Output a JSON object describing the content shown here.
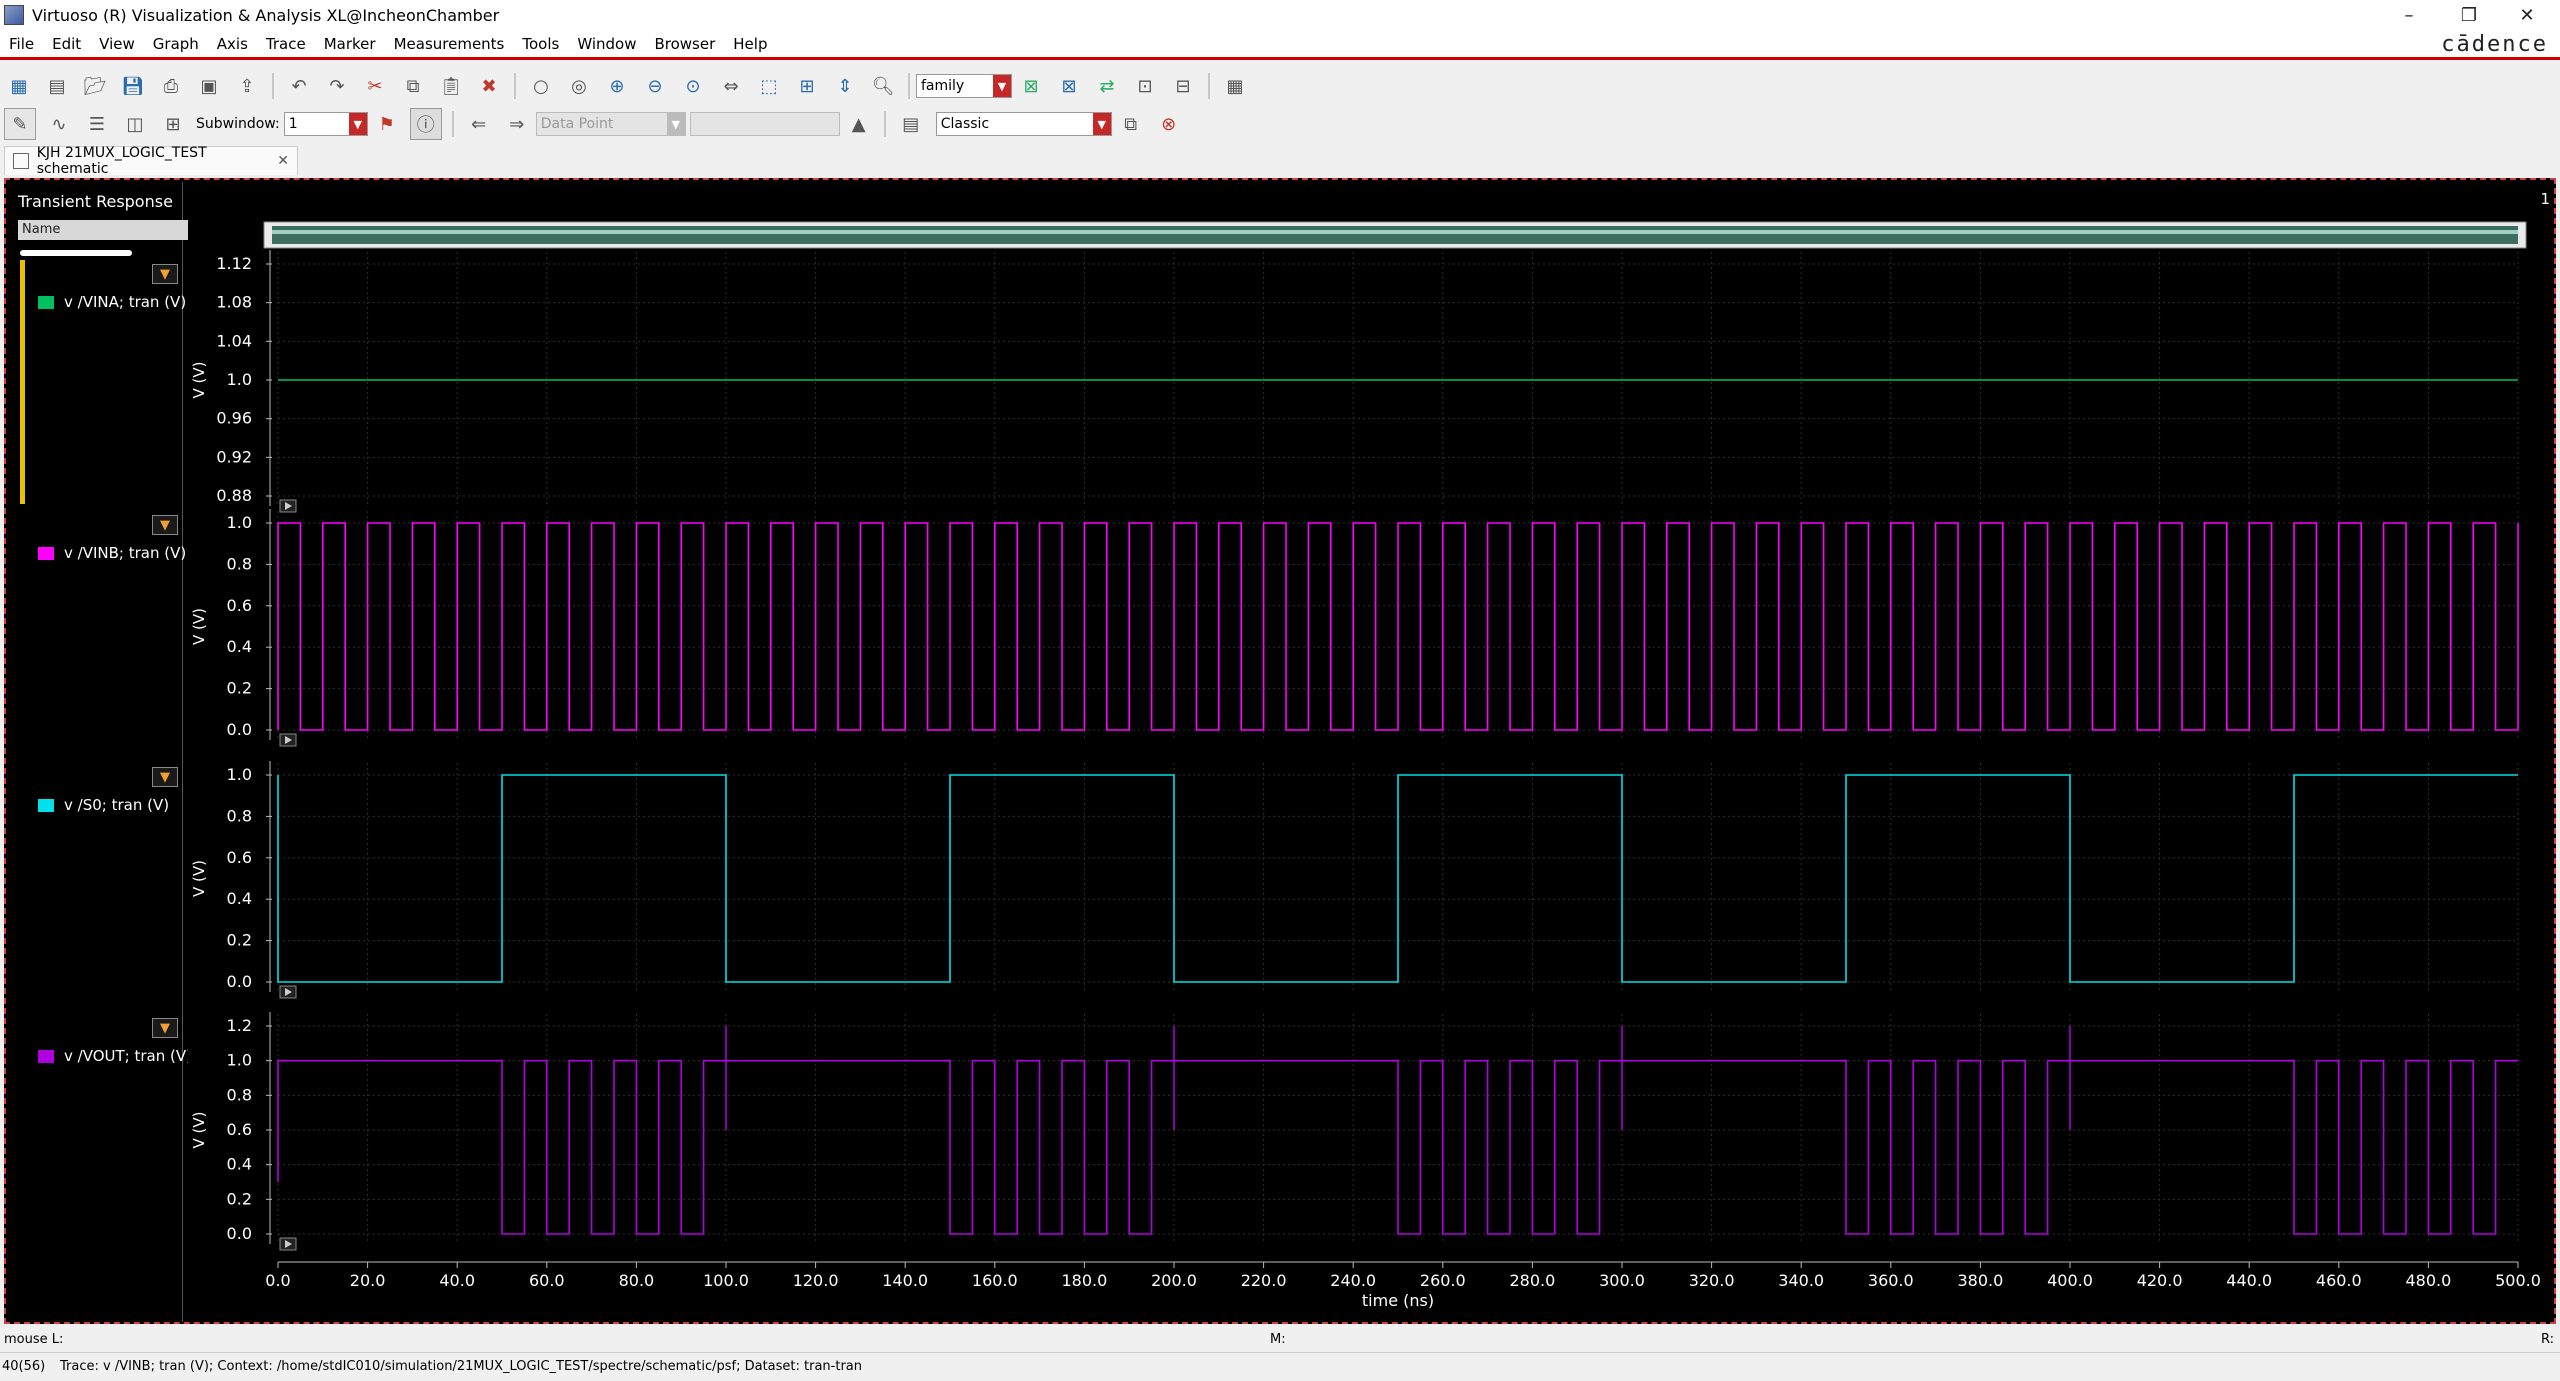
{
  "window": {
    "title": "Virtuoso (R) Visualization & Analysis XL@IncheonChamber",
    "brand": "cādence"
  },
  "menu": [
    "File",
    "Edit",
    "View",
    "Graph",
    "Axis",
    "Trace",
    "Marker",
    "Measurements",
    "Tools",
    "Window",
    "Browser",
    "Help"
  ],
  "toolbar": {
    "family_combo": "family",
    "subwindow_label": "Subwindow:",
    "subwindow_value": "1",
    "datapoint_combo": "Data Point",
    "style_combo": "Classic"
  },
  "tab": {
    "label": "KJH 21MUX_LOGIC_TEST schematic"
  },
  "plot": {
    "title": "Transient Response",
    "name_header": "Name",
    "panel_number": "1",
    "xlabel": "time (ns)"
  },
  "colors": {
    "vina": "#00c060",
    "vinb": "#ff00ff",
    "s0": "#00e0e8",
    "vout": "#b000e0",
    "grid": "#2e2e2e",
    "axis": "#bbbbbb"
  },
  "chart_data": [
    {
      "type": "line",
      "series": [
        {
          "name": "v /VINA; tran (V)",
          "x": [
            0,
            500
          ],
          "y": [
            1.0,
            1.0
          ]
        }
      ],
      "ylabel": "V (V)",
      "ylim": [
        0.88,
        1.12
      ],
      "yticks": [
        "1.12",
        "1.08",
        "1.04",
        "1.0",
        "0.96",
        "0.92",
        "0.88"
      ],
      "xlim": [
        0,
        500
      ]
    },
    {
      "type": "line",
      "series": [
        {
          "name": "v /VINB; tran (V)",
          "waveform": "square",
          "period_ns": 10,
          "high_first_ns": 0,
          "low": 0.0,
          "high": 1.0,
          "duty": 0.5
        }
      ],
      "ylabel": "V (V)",
      "ylim": [
        0.0,
        1.0
      ],
      "yticks": [
        "1.0",
        "0.8",
        "0.6",
        "0.4",
        "0.2",
        "0.0"
      ],
      "xlim": [
        0,
        500
      ]
    },
    {
      "type": "line",
      "series": [
        {
          "name": "v /S0; tran (V)",
          "waveform": "square",
          "period_ns": 100,
          "low": 0.0,
          "high": 1.0,
          "first_rise_ns": 50
        }
      ],
      "ylabel": "V (V)",
      "ylim": [
        0.0,
        1.0
      ],
      "yticks": [
        "1.0",
        "0.8",
        "0.6",
        "0.4",
        "0.2",
        "0.0"
      ],
      "xlim": [
        0,
        500
      ]
    },
    {
      "type": "line",
      "series": [
        {
          "name": "v /VOUT; tran (V)",
          "description_values": {
            "low": 0.0,
            "high": 1.0,
            "spike_high": 1.2
          }
        }
      ],
      "ylabel": "V (V)",
      "ylim": [
        0.0,
        1.2
      ],
      "yticks": [
        "1.2",
        "1.0",
        "0.8",
        "0.6",
        "0.4",
        "0.2",
        "0.0"
      ],
      "xlim": [
        0,
        500
      ]
    }
  ],
  "xticks": [
    "0.0",
    "20.0",
    "40.0",
    "60.0",
    "80.0",
    "100.0",
    "120.0",
    "140.0",
    "160.0",
    "180.0",
    "200.0",
    "220.0",
    "240.0",
    "260.0",
    "280.0",
    "300.0",
    "320.0",
    "340.0",
    "360.0",
    "380.0",
    "400.0",
    "420.0",
    "440.0",
    "460.0",
    "480.0",
    "500.0"
  ],
  "legend_items": [
    {
      "label": "v /VINA; tran (V)",
      "color": "#00c060"
    },
    {
      "label": "v /VINB; tran (V)",
      "color": "#ff00ff"
    },
    {
      "label": "v /S0; tran (V)",
      "color": "#00e0e8"
    },
    {
      "label": "v /VOUT; tran (V)",
      "color": "#b000e0"
    }
  ],
  "status": {
    "mouse": "mouse L:",
    "middle": "M:",
    "right": "R:",
    "counter": "40(56)",
    "message": "Trace: v /VINB; tran (V); Context: /home/stdIC010/simulation/21MUX_LOGIC_TEST/spectre/schematic/psf; Dataset: tran-tran"
  }
}
